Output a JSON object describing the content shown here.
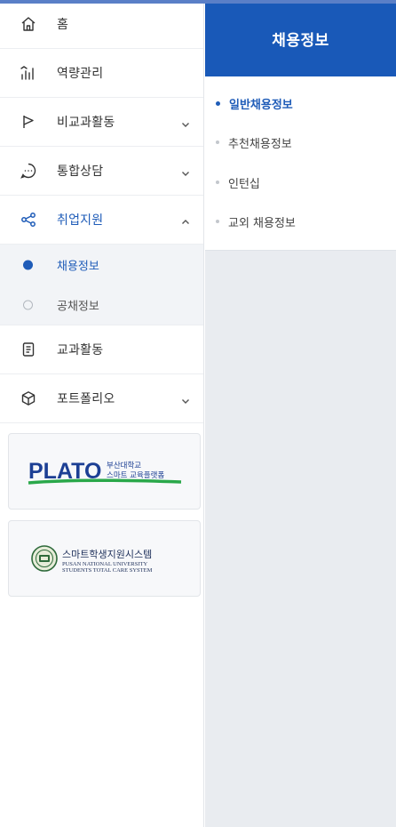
{
  "sidebar": {
    "items": [
      {
        "label": "홈",
        "icon": "home-icon"
      },
      {
        "label": "역량관리",
        "icon": "chart-bars-icon"
      },
      {
        "label": "비교과활동",
        "icon": "flag-icon"
      },
      {
        "label": "통합상담",
        "icon": "chat-bubble-icon"
      },
      {
        "label": "취업지원",
        "icon": "share-nodes-icon"
      },
      {
        "label": "교과활동",
        "icon": "document-icon"
      },
      {
        "label": "포트폴리오",
        "icon": "cube-icon"
      }
    ],
    "sub_items": [
      {
        "label": "채용정보"
      },
      {
        "label": "공채정보"
      }
    ],
    "banners": {
      "plato_logo": "PLATO",
      "plato_caption_line1": "부산대학교",
      "plato_caption_line2": "스마트 교육플랫폼",
      "smart_title": "스마트학생지원시스템",
      "smart_sub_line1": "PUSAN NATIONAL UNIVERSITY",
      "smart_sub_line2": "STUDENTS TOTAL CARE SYSTEM"
    }
  },
  "right_panel": {
    "title": "채용정보",
    "items": [
      {
        "label": "일반채용정보"
      },
      {
        "label": "추천채용정보"
      },
      {
        "label": "인턴십"
      },
      {
        "label": "교외 채용정보"
      }
    ]
  },
  "colors": {
    "accent": "#1959b8",
    "active_text": "#1f5cb8",
    "panel_bg": "#e9ecf0",
    "sub_bg": "#f2f4f7"
  }
}
